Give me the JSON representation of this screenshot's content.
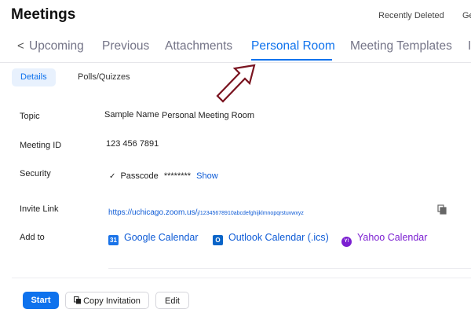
{
  "header": {
    "title": "Meetings",
    "recently_deleted": "Recently Deleted",
    "cut_link": "Ge"
  },
  "tabs": {
    "back_glyph": "<",
    "items": [
      "Upcoming",
      "Previous",
      "Attachments",
      "Personal Room",
      "Meeting Templates",
      "I"
    ],
    "active": "Personal Room"
  },
  "subtabs": {
    "details": "Details",
    "polls": "Polls/Quizzes"
  },
  "fields": {
    "topic_label": "Topic",
    "topic_prefix": "Sample Name",
    "topic_value": "Personal Meeting Room",
    "meeting_id_label": "Meeting ID",
    "meeting_id_value": "123 456 7891",
    "security_label": "Security",
    "security_check": "✓",
    "passcode_label": "Passcode",
    "passcode_mask": "********",
    "show_label": "Show",
    "invite_link_label": "Invite Link",
    "invite_link_domain": "https://uchicago.zoom.us/",
    "invite_link_path": "j/12345678910abcdefghijklmnopqrstuvwxyz",
    "add_to_label": "Add to"
  },
  "calendars": [
    {
      "label": "Google Calendar",
      "icon": "google-calendar-icon",
      "glyph": "31",
      "color": "#1a73e8"
    },
    {
      "label": "Outlook Calendar (.ics)",
      "icon": "outlook-calendar-icon",
      "glyph": "O",
      "color": "#0a64c8"
    },
    {
      "label": "Yahoo Calendar",
      "icon": "yahoo-calendar-icon",
      "glyph": "Y!",
      "color": "#7b1fd1"
    }
  ],
  "actions": {
    "start": "Start",
    "copy_invitation": "Copy Invitation",
    "edit": "Edit"
  },
  "colors": {
    "accent": "#0e72ed",
    "arrow": "#7a1420"
  }
}
